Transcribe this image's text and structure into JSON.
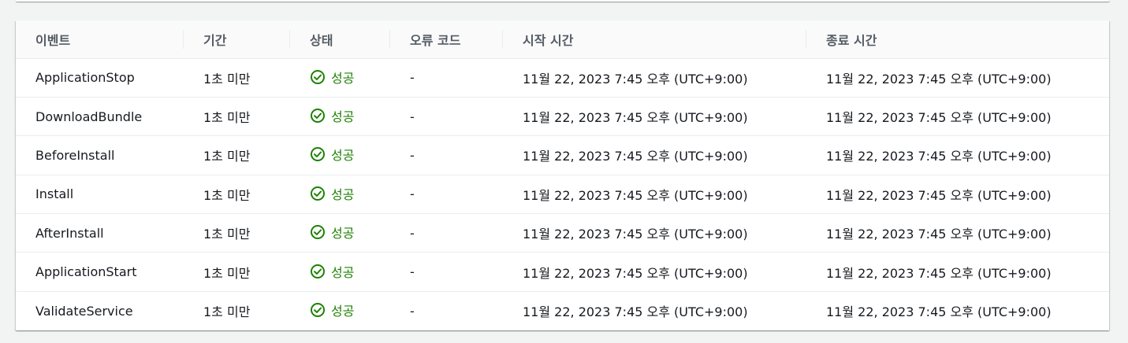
{
  "table": {
    "columns": [
      "이벤트",
      "기간",
      "상태",
      "오류 코드",
      "시작 시간",
      "종료 시간"
    ],
    "rows": [
      {
        "event": "ApplicationStop",
        "duration": "1초 미만",
        "status": "성공",
        "error_code": "-",
        "start_time": "11월 22, 2023 7:45 오후 (UTC+9:00)",
        "end_time": "11월 22, 2023 7:45 오후 (UTC+9:00)"
      },
      {
        "event": "DownloadBundle",
        "duration": "1초 미만",
        "status": "성공",
        "error_code": "-",
        "start_time": "11월 22, 2023 7:45 오후 (UTC+9:00)",
        "end_time": "11월 22, 2023 7:45 오후 (UTC+9:00)"
      },
      {
        "event": "BeforeInstall",
        "duration": "1초 미만",
        "status": "성공",
        "error_code": "-",
        "start_time": "11월 22, 2023 7:45 오후 (UTC+9:00)",
        "end_time": "11월 22, 2023 7:45 오후 (UTC+9:00)"
      },
      {
        "event": "Install",
        "duration": "1초 미만",
        "status": "성공",
        "error_code": "-",
        "start_time": "11월 22, 2023 7:45 오후 (UTC+9:00)",
        "end_time": "11월 22, 2023 7:45 오후 (UTC+9:00)"
      },
      {
        "event": "AfterInstall",
        "duration": "1초 미만",
        "status": "성공",
        "error_code": "-",
        "start_time": "11월 22, 2023 7:45 오후 (UTC+9:00)",
        "end_time": "11월 22, 2023 7:45 오후 (UTC+9:00)"
      },
      {
        "event": "ApplicationStart",
        "duration": "1초 미만",
        "status": "성공",
        "error_code": "-",
        "start_time": "11월 22, 2023 7:45 오후 (UTC+9:00)",
        "end_time": "11월 22, 2023 7:45 오후 (UTC+9:00)"
      },
      {
        "event": "ValidateService",
        "duration": "1초 미만",
        "status": "성공",
        "error_code": "-",
        "start_time": "11월 22, 2023 7:45 오후 (UTC+9:00)",
        "end_time": "11월 22, 2023 7:45 오후 (UTC+9:00)"
      }
    ]
  },
  "colors": {
    "success": "#1d8102",
    "header_text": "#545b64",
    "divider": "#eaeded"
  },
  "icons": {
    "status": "check-circle-icon"
  }
}
